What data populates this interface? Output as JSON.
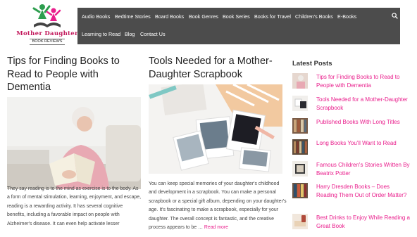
{
  "logo": {
    "title": "Mother Daughter",
    "subtitle": "BOOK REVIEWS"
  },
  "nav": {
    "items": [
      "Audio Books",
      "Bedtime Stories",
      "Board Books",
      "Book Genres",
      "Book Series",
      "Books for Travel",
      "Children's Books",
      "E-Books",
      "Learning to Read",
      "Blog",
      "Contact Us"
    ]
  },
  "posts": [
    {
      "title": "Tips for Finding Books to Read to People with Dementia",
      "excerpt": "They say reading is to the mind as exercise is to the body. As a form of mental stimulation, learning, enjoyment, and escape, reading is a rewarding activity. It has several cognitive benefits, including a favorable impact on people with Alzheimer's disease. It can even help activate lesser"
    },
    {
      "title": "Tools Needed for a Mother-Daughter Scrapbook",
      "excerpt": "You can keep special memories of your daughter's childhood and development in a scrapbook. You can make a personal scrapbook or a special gift album, depending on your daughter's age. It's fascinating to make a scrapbook, especially for your daughter. The overall concept is fantastic, and the creative process appears to be … ",
      "read_more": "Read more"
    }
  ],
  "sidebar": {
    "heading": "Latest Posts",
    "items": [
      "Tips for Finding Books to Read to People with Dementia",
      "Tools Needed for a Mother-Daughter Scrapbook",
      "Published Books With Long Titles",
      "Long Books You'll Want to Read",
      "Famous Children's Stories Written By Beatrix Potter",
      "Harry Dresden Books – Does Reading Them Out of Order Matter?",
      "Best Drinks to Enjoy While Reading a Great Book"
    ]
  },
  "colors": {
    "nav_bg": "#4c4c4c",
    "accent": "#e91e8c",
    "logo_green": "#2e9e4f",
    "logo_pink": "#c2185b"
  }
}
